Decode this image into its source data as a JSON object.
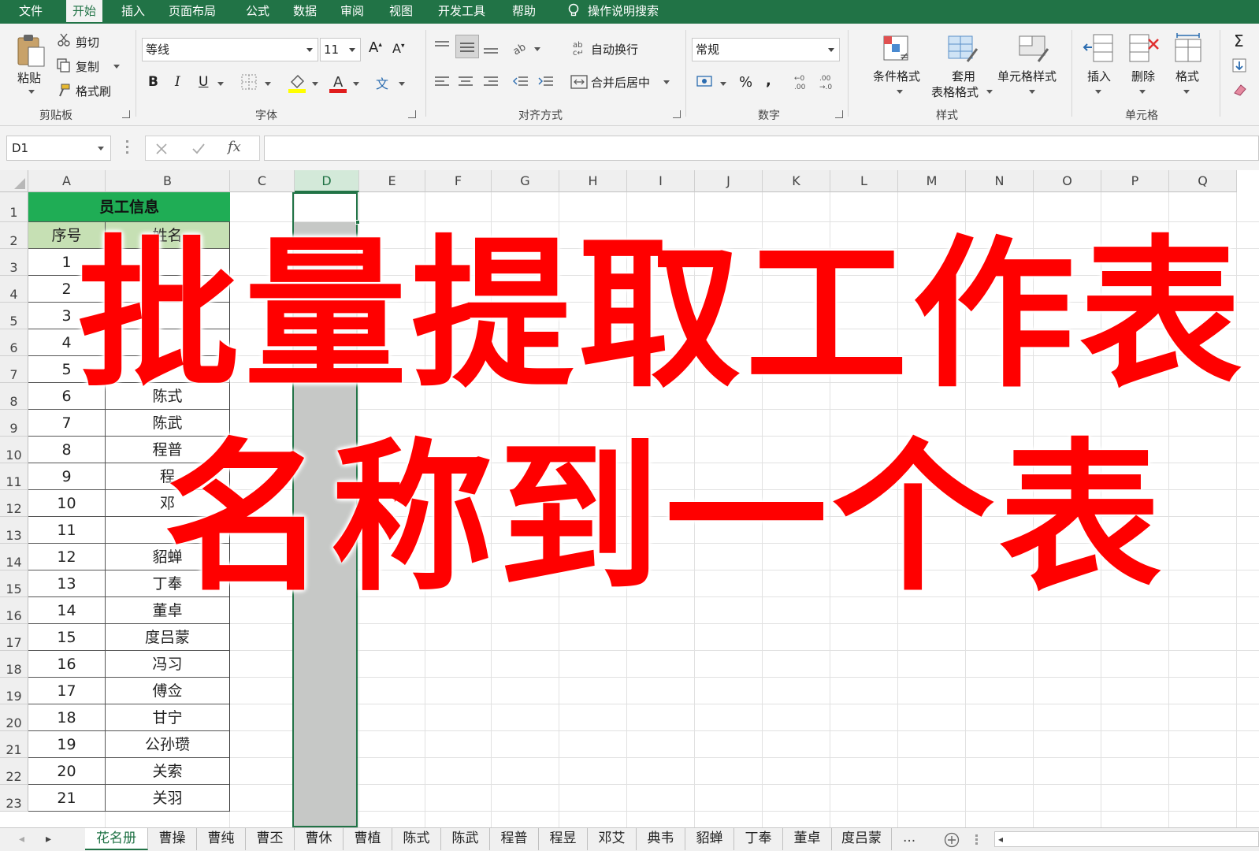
{
  "menu": {
    "items": [
      "文件",
      "开始",
      "插入",
      "页面布局",
      "公式",
      "数据",
      "审阅",
      "视图",
      "开发工具",
      "帮助"
    ],
    "active": "开始",
    "search": "操作说明搜索"
  },
  "ribbon": {
    "clipboard": {
      "paste": "粘贴",
      "cut": "剪切",
      "copy": "复制",
      "format_painter": "格式刷",
      "label": "剪贴板"
    },
    "font": {
      "name": "等线",
      "size": "11",
      "label": "字体",
      "bold": "B",
      "italic": "I",
      "underline": "U"
    },
    "alignment": {
      "wrap": "自动换行",
      "merge": "合并后居中",
      "label": "对齐方式"
    },
    "number": {
      "format": "常规",
      "percent": "%",
      "comma": ",",
      "label": "数字"
    },
    "styles": {
      "conditional": "条件格式",
      "table_format_1": "套用",
      "table_format_2": "表格格式",
      "cell_styles": "单元格样式",
      "label": "样式"
    },
    "cells": {
      "insert": "插入",
      "delete": "删除",
      "format": "格式",
      "label": "单元格"
    },
    "editing": {
      "sigma": "Σ"
    }
  },
  "formula_bar": {
    "name_box": "D1",
    "fx": "fx"
  },
  "columns": [
    "A",
    "B",
    "C",
    "D",
    "E",
    "F",
    "G",
    "H",
    "I",
    "J",
    "K",
    "L",
    "M",
    "N",
    "O",
    "P",
    "Q"
  ],
  "selected_column": "D",
  "rows": [
    "1",
    "2",
    "3",
    "4",
    "5",
    "6",
    "7",
    "8",
    "9",
    "10",
    "11",
    "12",
    "13",
    "14",
    "15",
    "16",
    "17",
    "18",
    "19",
    "20",
    "21",
    "22",
    "23"
  ],
  "table": {
    "title": "员工信息",
    "headers": [
      "序号",
      "姓名"
    ],
    "data": [
      [
        "1",
        ""
      ],
      [
        "2",
        ""
      ],
      [
        "3",
        ""
      ],
      [
        "4",
        ""
      ],
      [
        "5",
        ""
      ],
      [
        "6",
        "陈式"
      ],
      [
        "7",
        "陈武"
      ],
      [
        "8",
        "程普"
      ],
      [
        "9",
        "程"
      ],
      [
        "10",
        "邓"
      ],
      [
        "11",
        ""
      ],
      [
        "12",
        "貂蝉"
      ],
      [
        "13",
        "丁奉"
      ],
      [
        "14",
        "董卓"
      ],
      [
        "15",
        "度吕蒙"
      ],
      [
        "16",
        "冯习"
      ],
      [
        "17",
        "傅佥"
      ],
      [
        "18",
        "甘宁"
      ],
      [
        "19",
        "公孙瓒"
      ],
      [
        "20",
        "关索"
      ],
      [
        "21",
        "关羽"
      ]
    ]
  },
  "sheet_tabs": [
    "花名册",
    "曹操",
    "曹纯",
    "曹丕",
    "曹休",
    "曹植",
    "陈式",
    "陈武",
    "程普",
    "程昱",
    "邓艾",
    "典韦",
    "貂蝉",
    "丁奉",
    "董卓",
    "度吕蒙"
  ],
  "active_tab": "花名册",
  "tabs_more": "...",
  "overlay": {
    "line1": "批量提取工作表",
    "line2": "名称到一个表"
  },
  "colors": {
    "excel_green": "#217346",
    "header_green": "#1fad55",
    "subheader_green": "#c6e0b4",
    "overlay_red": "#ff0000",
    "selected_col": "#c6c8c6"
  }
}
